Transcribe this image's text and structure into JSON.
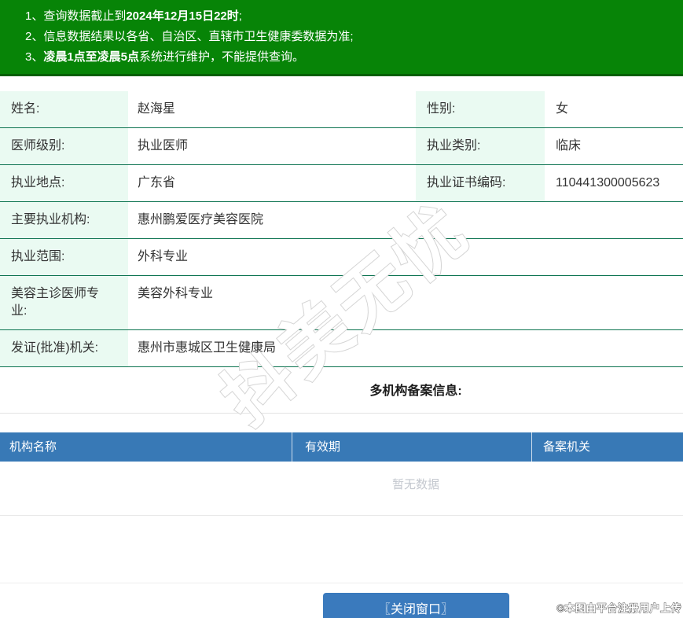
{
  "notices": [
    {
      "pre": "1、查询数据截止到",
      "bold": "2024年12月15日22时",
      "post": ";"
    },
    {
      "pre": "2、信息数据结果以各省、自治区、直辖市卫生健康委数据为准;",
      "bold": "",
      "post": ""
    },
    {
      "pre": "3、",
      "bold": "凌晨1点至凌晨5点",
      "post": "系统进行维护，不能提供查询。"
    }
  ],
  "practitioner": {
    "rows": [
      {
        "cells": [
          {
            "label": "姓名:",
            "value": "赵海星"
          },
          {
            "label": "性别:",
            "value": "女"
          }
        ]
      },
      {
        "cells": [
          {
            "label": "医师级别:",
            "value": "执业医师"
          },
          {
            "label": "执业类别:",
            "value": "临床"
          }
        ]
      },
      {
        "cells": [
          {
            "label": "执业地点:",
            "value": "广东省"
          },
          {
            "label": "执业证书编码:",
            "value": "110441300005623"
          }
        ]
      },
      {
        "cells": [
          {
            "label": "主要执业机构:",
            "value": "惠州鹏爱医疗美容医院"
          }
        ]
      },
      {
        "cells": [
          {
            "label": "执业范围:",
            "value": "外科专业"
          }
        ]
      },
      {
        "cells": [
          {
            "label": "美容主诊医师专业:",
            "value": "美容外科专业"
          }
        ]
      },
      {
        "cells": [
          {
            "label": "发证(批准)机关:",
            "value": "惠州市惠城区卫生健康局"
          }
        ]
      }
    ]
  },
  "multi_org": {
    "heading": "多机构备案信息:",
    "columns": [
      "机构名称",
      "有效期",
      "备案机关"
    ],
    "empty_text": "暂无数据"
  },
  "footer": {
    "close_button": "〖关闭窗口〗"
  },
  "watermark": "抖美无忧",
  "copyright": "©本图由平台注册用户上传",
  "colors": {
    "green-bar": "#078407",
    "row-border": "#0c7350",
    "mint": "#eafaf2",
    "blue-header": "#3879b6",
    "blue-button": "#3a7abd",
    "empty-gray": "#c4c8cf",
    "watermark-stroke": "#d4d4d4"
  }
}
